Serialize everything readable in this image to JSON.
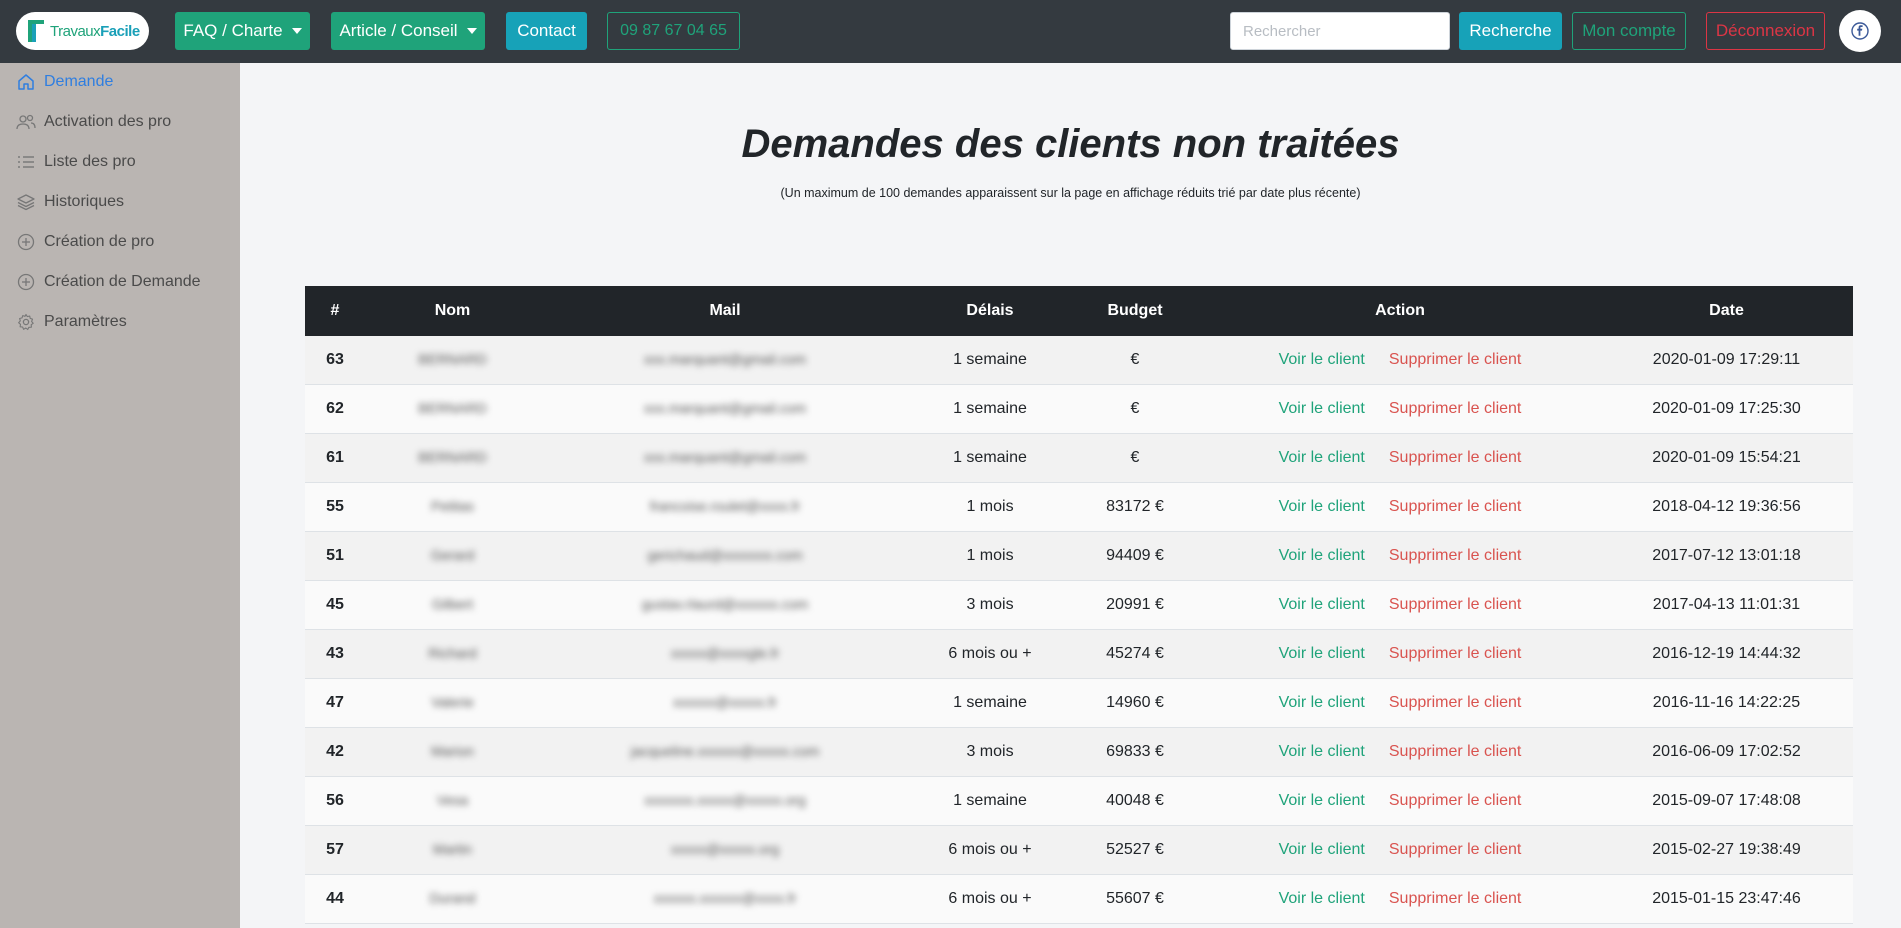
{
  "brand": {
    "name_part1": "Travaux",
    "name_part2": "Facile"
  },
  "nav": {
    "faq_label": "FAQ / Charte",
    "article_label": "Article / Conseil",
    "contact_label": "Contact",
    "phone_label": "09 87 67 04 65",
    "search_placeholder": "Rechercher",
    "search_button": "Recherche",
    "account_label": "Mon compte",
    "logout_label": "Déconnexion"
  },
  "sidebar": {
    "items": [
      {
        "label": "Demande",
        "icon": "home-icon",
        "active": true
      },
      {
        "label": "Activation des pro",
        "icon": "users-icon"
      },
      {
        "label": "Liste des pro",
        "icon": "list-icon"
      },
      {
        "label": "Historiques",
        "icon": "layers-icon"
      },
      {
        "label": "Création de pro",
        "icon": "plus-circle-icon"
      },
      {
        "label": "Création de Demande",
        "icon": "plus-circle-icon"
      },
      {
        "label": "Paramètres",
        "icon": "gear-icon"
      }
    ]
  },
  "page": {
    "title": "Demandes des clients non traitées",
    "subtitle": "(Un maximum de 100 demandes apparaissent sur la page en affichage réduits trié par date plus récente)"
  },
  "table": {
    "headers": [
      "#",
      "Nom",
      "Mail",
      "Délais",
      "Budget",
      "Action",
      "Date"
    ],
    "action_view": "Voir le client",
    "action_delete": "Supprimer le client",
    "rows": [
      {
        "id": "63",
        "nom": "BERNARD",
        "mail": "xxx.marquant@gmail.com",
        "delais": "1 semaine",
        "budget": "€",
        "date": "2020-01-09 17:29:11"
      },
      {
        "id": "62",
        "nom": "BERNARD",
        "mail": "xxx.marquant@gmail.com",
        "delais": "1 semaine",
        "budget": "€",
        "date": "2020-01-09 17:25:30"
      },
      {
        "id": "61",
        "nom": "BERNARD",
        "mail": "xxx.marquant@gmail.com",
        "delais": "1 semaine",
        "budget": "€",
        "date": "2020-01-09 15:54:21"
      },
      {
        "id": "55",
        "nom": "Petitas",
        "mail": "francoise.roulet@xxxx.fr",
        "delais": "1 mois",
        "budget": "83172 €",
        "date": "2018-04-12 19:36:56"
      },
      {
        "id": "51",
        "nom": "Gerard",
        "mail": "gerichaud@xxxxxxx.com",
        "delais": "1 mois",
        "budget": "94409 €",
        "date": "2017-07-12 13:01:18"
      },
      {
        "id": "45",
        "nom": "Gilbert",
        "mail": "gustav.rlaurd@xxxxxx.com",
        "delais": "3 mois",
        "budget": "20991 €",
        "date": "2017-04-13 11:01:31"
      },
      {
        "id": "43",
        "nom": "Richard",
        "mail": "xxxxx@xxxxgle.fr",
        "delais": "6 mois ou +",
        "budget": "45274 €",
        "date": "2016-12-19 14:44:32"
      },
      {
        "id": "47",
        "nom": "Valerie",
        "mail": "xxxxxx@xxxxx.fr",
        "delais": "1 semaine",
        "budget": "14960 €",
        "date": "2016-11-16 14:22:25"
      },
      {
        "id": "42",
        "nom": "Marion",
        "mail": "jacqueline.xxxxxx@xxxxx.com",
        "delais": "3 mois",
        "budget": "69833 €",
        "date": "2016-06-09 17:02:52"
      },
      {
        "id": "56",
        "nom": "Vesa",
        "mail": "xxxxxxx.xxxxx@xxxxx.org",
        "delais": "1 semaine",
        "budget": "40048 €",
        "date": "2015-09-07 17:48:08"
      },
      {
        "id": "57",
        "nom": "Martin",
        "mail": "xxxxx@xxxxx.org",
        "delais": "6 mois ou +",
        "budget": "52527 €",
        "date": "2015-02-27 19:38:49"
      },
      {
        "id": "44",
        "nom": "Durand",
        "mail": "xxxxxx.xxxxxx@xxxx.fr",
        "delais": "6 mois ou +",
        "budget": "55607 €",
        "date": "2015-01-15 23:47:46"
      }
    ]
  }
}
